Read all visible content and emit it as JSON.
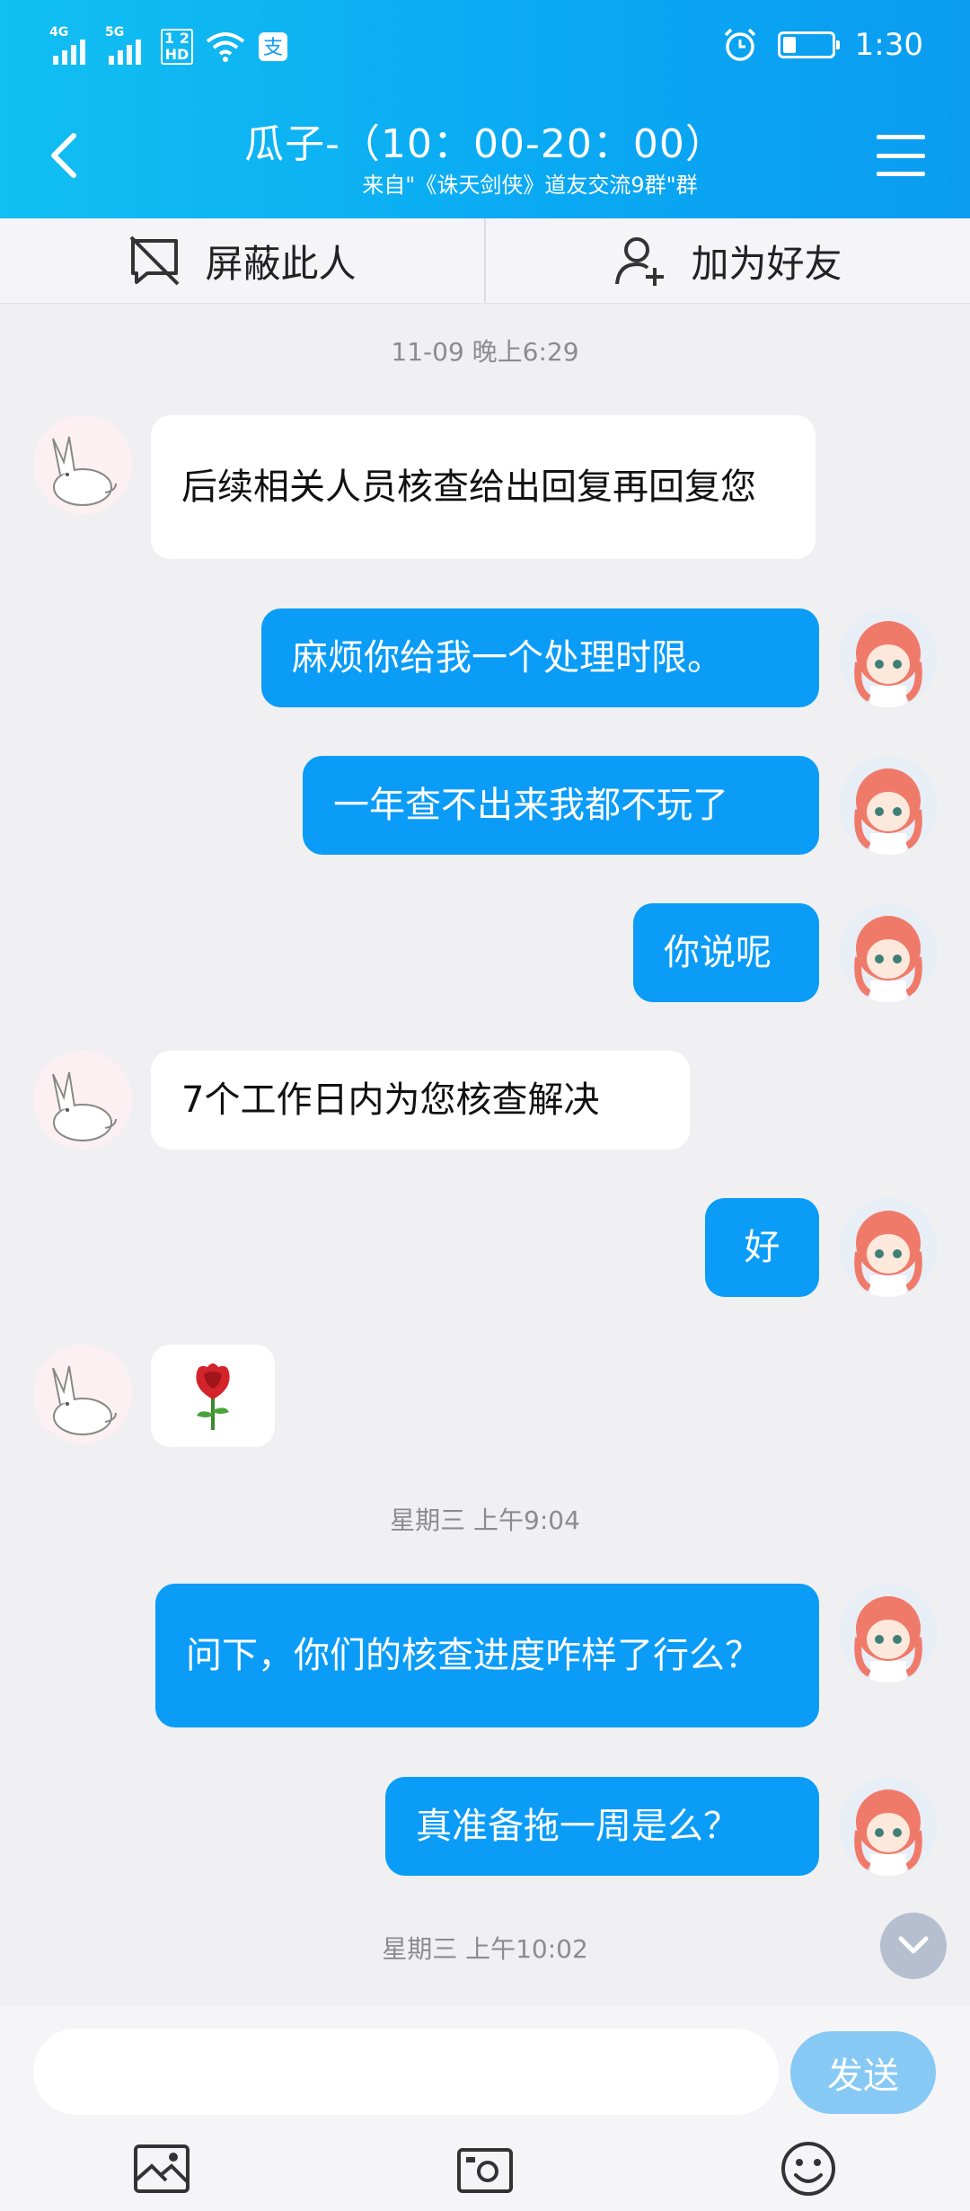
{
  "status": {
    "signal1_label": "4G",
    "signal2_label": "5G",
    "hd_label_top": "1 2",
    "hd_label_bottom": "HD",
    "time": "1:30"
  },
  "header": {
    "title": "瓜子-（10：00-20：00）",
    "subtitle": "来自\"《诛天剑侠》道友交流9群\"群"
  },
  "actions": {
    "block_label": "屏蔽此人",
    "add_friend_label": "加为好友"
  },
  "messages": {
    "t1": "11-09 晚上6:29",
    "m1": "后续相关人员核查给出回复再回复您",
    "m2": "麻烦你给我一个处理时限。",
    "m3": "一年查不出来我都不玩了",
    "m4": "你说呢",
    "m5": "7个工作日内为您核查解决",
    "m6": "好",
    "m7_icon": "rose-emoji",
    "t2": "星期三 上午9:04",
    "m8": "问下，你们的核查进度咋样了行么？",
    "m9": "真准备拖一周是么？",
    "t3": "星期三 上午10:02"
  },
  "input": {
    "placeholder": "",
    "send_label": "发送"
  },
  "toolbar": {
    "icons": [
      "image-icon",
      "camera-icon",
      "emoji-icon"
    ]
  },
  "colors": {
    "header_start": "#11bff2",
    "header_end": "#0b9cf0",
    "outgoing_bubble": "#0a9cf7",
    "incoming_bubble": "#ffffff",
    "send_button": "#86c9f5"
  }
}
